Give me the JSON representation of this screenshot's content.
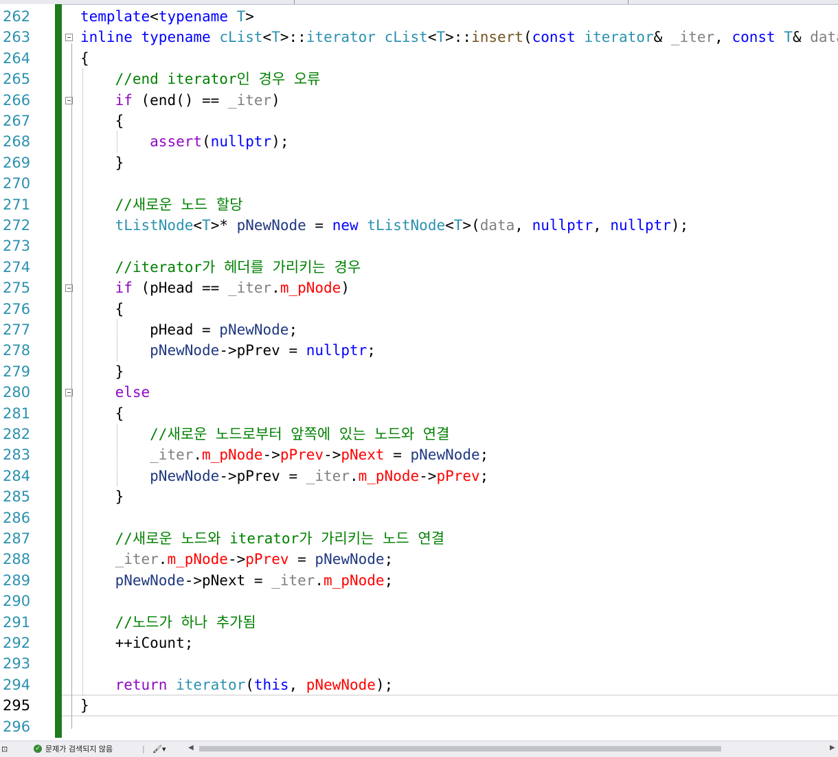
{
  "editor": {
    "current_line": 295,
    "lines": [
      {
        "n": 262,
        "segs": [
          [
            "kw",
            "template"
          ],
          [
            "gl",
            "<"
          ],
          [
            "kw",
            "typename"
          ],
          [
            "gl",
            " "
          ],
          [
            "ty",
            "T"
          ],
          [
            "gl",
            ">"
          ]
        ]
      },
      {
        "n": 263,
        "fold": true,
        "segs": [
          [
            "kw",
            "inline"
          ],
          [
            "gl",
            " "
          ],
          [
            "kw",
            "typename"
          ],
          [
            "gl",
            " "
          ],
          [
            "ty",
            "cList"
          ],
          [
            "gl",
            "<"
          ],
          [
            "ty",
            "T"
          ],
          [
            "gl",
            ">::"
          ],
          [
            "ty",
            "iterator"
          ],
          [
            "gl",
            " "
          ],
          [
            "ty",
            "cList"
          ],
          [
            "gl",
            "<"
          ],
          [
            "ty",
            "T"
          ],
          [
            "gl",
            ">::"
          ],
          [
            "fn",
            "insert"
          ],
          [
            "gl",
            "("
          ],
          [
            "kw",
            "const"
          ],
          [
            "gl",
            " "
          ],
          [
            "ty",
            "iterator"
          ],
          [
            "gl",
            "& "
          ],
          [
            "par",
            "_iter"
          ],
          [
            "gl",
            ", "
          ],
          [
            "kw",
            "const"
          ],
          [
            "gl",
            " "
          ],
          [
            "ty",
            "T"
          ],
          [
            "gl",
            "& "
          ],
          [
            "par",
            "data"
          ],
          [
            "gl",
            ")"
          ]
        ]
      },
      {
        "n": 264,
        "segs": [
          [
            "gl",
            "{"
          ]
        ]
      },
      {
        "n": 265,
        "segs": [
          [
            "gl",
            "    "
          ],
          [
            "cm",
            "//end iterator인 경우 오류"
          ]
        ]
      },
      {
        "n": 266,
        "fold": true,
        "segs": [
          [
            "gl",
            "    "
          ],
          [
            "mac",
            "if"
          ],
          [
            "gl",
            " (end() == "
          ],
          [
            "par",
            "_iter"
          ],
          [
            "gl",
            ")"
          ]
        ]
      },
      {
        "n": 267,
        "segs": [
          [
            "gl",
            "    {"
          ]
        ]
      },
      {
        "n": 268,
        "segs": [
          [
            "gl",
            "        "
          ],
          [
            "mac",
            "assert"
          ],
          [
            "gl",
            "("
          ],
          [
            "kw",
            "nullptr"
          ],
          [
            "gl",
            ");"
          ]
        ]
      },
      {
        "n": 269,
        "segs": [
          [
            "gl",
            "    }"
          ]
        ]
      },
      {
        "n": 270,
        "segs": []
      },
      {
        "n": 271,
        "segs": [
          [
            "gl",
            "    "
          ],
          [
            "cm",
            "//새로운 노드 할당"
          ]
        ]
      },
      {
        "n": 272,
        "segs": [
          [
            "gl",
            "    "
          ],
          [
            "ty",
            "tListNode"
          ],
          [
            "gl",
            "<"
          ],
          [
            "ty",
            "T"
          ],
          [
            "gl",
            ">* "
          ],
          [
            "loc",
            "pNewNode"
          ],
          [
            "gl",
            " = "
          ],
          [
            "kw",
            "new"
          ],
          [
            "gl",
            " "
          ],
          [
            "ty",
            "tListNode"
          ],
          [
            "gl",
            "<"
          ],
          [
            "ty",
            "T"
          ],
          [
            "gl",
            ">("
          ],
          [
            "par",
            "data"
          ],
          [
            "gl",
            ", "
          ],
          [
            "kw",
            "nullptr"
          ],
          [
            "gl",
            ", "
          ],
          [
            "kw",
            "nullptr"
          ],
          [
            "gl",
            ");"
          ]
        ]
      },
      {
        "n": 273,
        "segs": []
      },
      {
        "n": 274,
        "segs": [
          [
            "gl",
            "    "
          ],
          [
            "cm",
            "//iterator가 헤더를 가리키는 경우"
          ]
        ]
      },
      {
        "n": 275,
        "fold": true,
        "segs": [
          [
            "gl",
            "    "
          ],
          [
            "mac",
            "if"
          ],
          [
            "gl",
            " (pHead == "
          ],
          [
            "par",
            "_iter"
          ],
          [
            "gl",
            "."
          ],
          [
            "mem",
            "m_pNode"
          ],
          [
            "gl",
            ")"
          ]
        ]
      },
      {
        "n": 276,
        "segs": [
          [
            "gl",
            "    {"
          ]
        ]
      },
      {
        "n": 277,
        "segs": [
          [
            "gl",
            "        pHead = "
          ],
          [
            "loc",
            "pNewNode"
          ],
          [
            "gl",
            ";"
          ]
        ]
      },
      {
        "n": 278,
        "segs": [
          [
            "gl",
            "        "
          ],
          [
            "loc",
            "pNewNode"
          ],
          [
            "gl",
            "->pPrev = "
          ],
          [
            "kw",
            "nullptr"
          ],
          [
            "gl",
            ";"
          ]
        ]
      },
      {
        "n": 279,
        "segs": [
          [
            "gl",
            "    }"
          ]
        ]
      },
      {
        "n": 280,
        "fold": true,
        "segs": [
          [
            "gl",
            "    "
          ],
          [
            "mac",
            "else"
          ]
        ]
      },
      {
        "n": 281,
        "segs": [
          [
            "gl",
            "    {"
          ]
        ]
      },
      {
        "n": 282,
        "segs": [
          [
            "gl",
            "        "
          ],
          [
            "cm",
            "//새로운 노드로부터 앞쪽에 있는 노드와 연결"
          ]
        ]
      },
      {
        "n": 283,
        "segs": [
          [
            "gl",
            "        "
          ],
          [
            "par",
            "_iter"
          ],
          [
            "gl",
            "."
          ],
          [
            "mem",
            "m_pNode"
          ],
          [
            "gl",
            "->"
          ],
          [
            "mem",
            "pPrev"
          ],
          [
            "gl",
            "->"
          ],
          [
            "mem",
            "pNext"
          ],
          [
            "gl",
            " = "
          ],
          [
            "loc",
            "pNewNode"
          ],
          [
            "gl",
            ";"
          ]
        ]
      },
      {
        "n": 284,
        "segs": [
          [
            "gl",
            "        "
          ],
          [
            "loc",
            "pNewNode"
          ],
          [
            "gl",
            "->pPrev = "
          ],
          [
            "par",
            "_iter"
          ],
          [
            "gl",
            "."
          ],
          [
            "mem",
            "m_pNode"
          ],
          [
            "gl",
            "->"
          ],
          [
            "mem",
            "pPrev"
          ],
          [
            "gl",
            ";"
          ]
        ]
      },
      {
        "n": 285,
        "segs": [
          [
            "gl",
            "    }"
          ]
        ]
      },
      {
        "n": 286,
        "segs": []
      },
      {
        "n": 287,
        "segs": [
          [
            "gl",
            "    "
          ],
          [
            "cm",
            "//새로운 노드와 iterator가 가리키는 노드 연결"
          ]
        ]
      },
      {
        "n": 288,
        "segs": [
          [
            "gl",
            "    "
          ],
          [
            "par",
            "_iter"
          ],
          [
            "gl",
            "."
          ],
          [
            "mem",
            "m_pNode"
          ],
          [
            "gl",
            "->"
          ],
          [
            "mem",
            "pPrev"
          ],
          [
            "gl",
            " = "
          ],
          [
            "loc",
            "pNewNode"
          ],
          [
            "gl",
            ";"
          ]
        ]
      },
      {
        "n": 289,
        "segs": [
          [
            "gl",
            "    "
          ],
          [
            "loc",
            "pNewNode"
          ],
          [
            "gl",
            "->pNext = "
          ],
          [
            "par",
            "_iter"
          ],
          [
            "gl",
            "."
          ],
          [
            "mem",
            "m_pNode"
          ],
          [
            "gl",
            ";"
          ]
        ]
      },
      {
        "n": 290,
        "segs": []
      },
      {
        "n": 291,
        "segs": [
          [
            "gl",
            "    "
          ],
          [
            "cm",
            "//노드가 하나 추가됨"
          ]
        ]
      },
      {
        "n": 292,
        "segs": [
          [
            "gl",
            "    ++iCount;"
          ]
        ]
      },
      {
        "n": 293,
        "segs": []
      },
      {
        "n": 294,
        "segs": [
          [
            "gl",
            "    "
          ],
          [
            "mac",
            "return"
          ],
          [
            "gl",
            " "
          ],
          [
            "ty",
            "iterator"
          ],
          [
            "gl",
            "("
          ],
          [
            "kw",
            "this"
          ],
          [
            "gl",
            ", "
          ],
          [
            "mem",
            "pNewNode"
          ],
          [
            "gl",
            ");"
          ]
        ]
      },
      {
        "n": 295,
        "segs": [
          [
            "gl",
            "}"
          ]
        ]
      },
      {
        "n": 296,
        "segs": []
      }
    ]
  },
  "status": {
    "issues_text": "문제가 검색되지 않음"
  },
  "colors": {
    "change_bar": "#1e7b1e",
    "comment": "#008000",
    "keyword": "#0000ff",
    "type": "#2b91af",
    "member": "#ff0000",
    "macro": "#8f08c4"
  }
}
